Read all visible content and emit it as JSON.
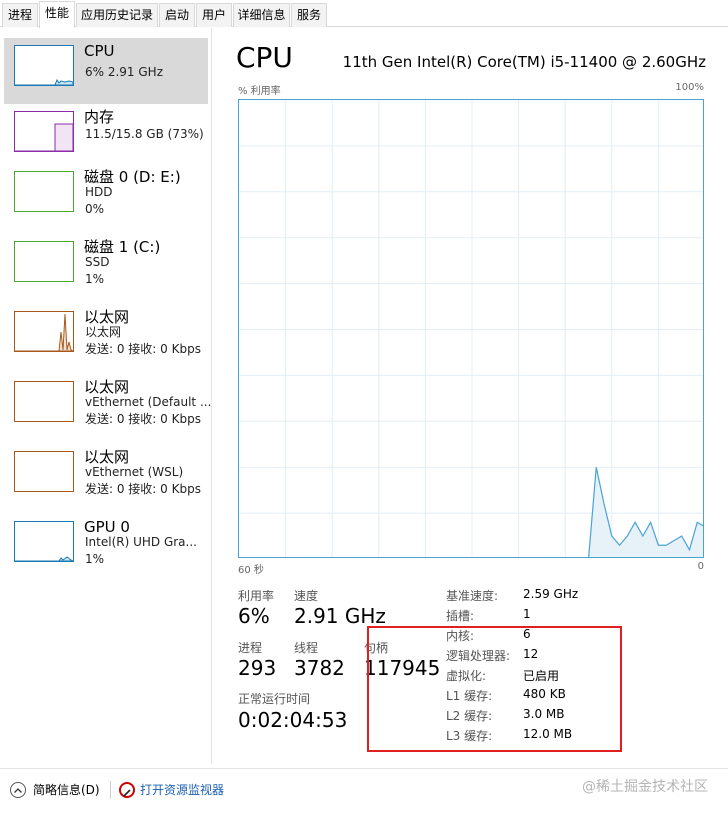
{
  "tabs": [
    "进程",
    "性能",
    "应用历史记录",
    "启动",
    "用户",
    "详细信息",
    "服务"
  ],
  "active_tab": 1,
  "sidebar": {
    "items": [
      {
        "title": "CPU",
        "lines": [
          "6% 2.91 GHz"
        ],
        "color": "#1979b3"
      },
      {
        "title": "内存",
        "lines": [
          "11.5/15.8 GB (73%)"
        ],
        "color": "#8b2ca8"
      },
      {
        "title": "磁盘 0 (D: E:)",
        "lines": [
          "HDD",
          "0%"
        ],
        "color": "#4da632"
      },
      {
        "title": "磁盘 1 (C:)",
        "lines": [
          "SSD",
          "1%"
        ],
        "color": "#4da632"
      },
      {
        "title": "以太网",
        "lines": [
          "以太网",
          "发送: 0 接收: 0 Kbps"
        ],
        "color": "#a7581b"
      },
      {
        "title": "以太网",
        "lines": [
          "vEthernet (Default ...",
          "发送: 0 接收: 0 Kbps"
        ],
        "color": "#a7581b"
      },
      {
        "title": "以太网",
        "lines": [
          "vEthernet (WSL)",
          "发送: 0 接收: 0 Kbps"
        ],
        "color": "#a7581b"
      },
      {
        "title": "GPU 0",
        "lines": [
          "Intel(R) UHD Gra...",
          "1%"
        ],
        "color": "#1979b3"
      }
    ]
  },
  "main": {
    "title": "CPU",
    "model": "11th Gen Intel(R) Core(TM) i5-11400 @ 2.60GHz",
    "chart_top_left": "% 利用率",
    "chart_top_right": "100%",
    "chart_bottom_left": "60 秒",
    "chart_bottom_right": "0",
    "stats": {
      "util_label": "利用率",
      "util_value": "6%",
      "speed_label": "速度",
      "speed_value": "2.91 GHz",
      "proc_label": "进程",
      "proc_value": "293",
      "thread_label": "线程",
      "thread_value": "3782",
      "handle_label": "句柄",
      "handle_value": "117945",
      "uptime_label": "正常运行时间",
      "uptime_value": "0:02:04:53"
    },
    "specs": [
      {
        "label": "基准速度:",
        "value": "2.59 GHz"
      },
      {
        "label": "插槽:",
        "value": "1"
      },
      {
        "label": "内核:",
        "value": "6"
      },
      {
        "label": "逻辑处理器:",
        "value": "12"
      },
      {
        "label": "虚拟化:",
        "value": "已启用"
      },
      {
        "label": "L1 缓存:",
        "value": "480 KB"
      },
      {
        "label": "L2 缓存:",
        "value": "3.0 MB"
      },
      {
        "label": "L3 缓存:",
        "value": "12.0 MB"
      }
    ]
  },
  "chart_data": {
    "type": "area",
    "x": [
      60,
      59,
      58,
      57,
      56,
      55,
      54,
      53,
      52,
      51,
      50,
      49,
      48,
      47,
      46,
      45,
      44,
      43,
      42,
      41,
      40,
      39,
      38,
      37,
      36,
      35,
      34,
      33,
      32,
      31,
      30,
      29,
      28,
      27,
      26,
      25,
      24,
      23,
      22,
      21,
      20,
      19,
      18,
      17,
      16,
      15,
      14,
      13,
      12,
      11,
      10,
      9,
      8,
      7,
      6,
      5,
      4,
      3,
      2,
      1,
      0
    ],
    "values": [
      0,
      0,
      0,
      0,
      0,
      0,
      0,
      0,
      0,
      0,
      0,
      0,
      0,
      0,
      0,
      0,
      0,
      0,
      0,
      0,
      0,
      0,
      0,
      0,
      0,
      0,
      0,
      0,
      0,
      0,
      0,
      0,
      0,
      0,
      0,
      0,
      0,
      0,
      0,
      0,
      0,
      0,
      0,
      0,
      0,
      0,
      20,
      12,
      5,
      3,
      5,
      8,
      5,
      8,
      3,
      3,
      4,
      5,
      2,
      8,
      7
    ],
    "ylim": [
      0,
      100
    ],
    "xlim": [
      60,
      0
    ],
    "grid": true,
    "line_color": "#4aa3d6"
  },
  "footer": {
    "summary_label": "简略信息(D)",
    "monitor_label": "打开资源监视器",
    "watermark": "@稀土掘金技术社区"
  }
}
